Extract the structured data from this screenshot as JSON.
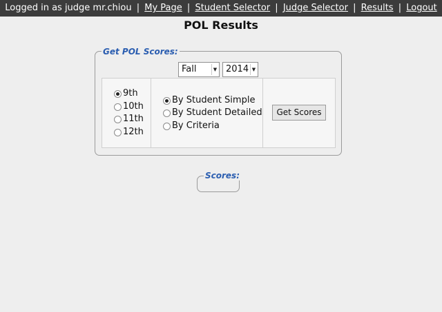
{
  "topbar": {
    "logged_in_text": "Logged in as judge mr.chiou",
    "separator": "|",
    "links": [
      "My Page",
      "Student Selector",
      "Judge Selector",
      "Results",
      "Logout"
    ]
  },
  "page_title": "POL Results",
  "get_scores_box": {
    "legend": "Get POL Scores:",
    "season_select": {
      "value": "Fall"
    },
    "year_select": {
      "value": "2014"
    },
    "grades": [
      {
        "label": "9th",
        "checked": true
      },
      {
        "label": "10th",
        "checked": false
      },
      {
        "label": "11th",
        "checked": false
      },
      {
        "label": "12th",
        "checked": false
      }
    ],
    "report_types": [
      {
        "label": "By Student Simple",
        "checked": true
      },
      {
        "label": "By Student Detailed",
        "checked": false
      },
      {
        "label": "By Criteria",
        "checked": false
      }
    ],
    "button_label": "Get Scores"
  },
  "scores_box": {
    "legend": "Scores:"
  },
  "icons": {
    "dropdown": "chevron-down-icon",
    "radio": "radio-icon"
  },
  "colors": {
    "topbar_bg": "#3c3c3c",
    "legend_text": "#2a5db0",
    "page_bg": "#eeeeee"
  }
}
